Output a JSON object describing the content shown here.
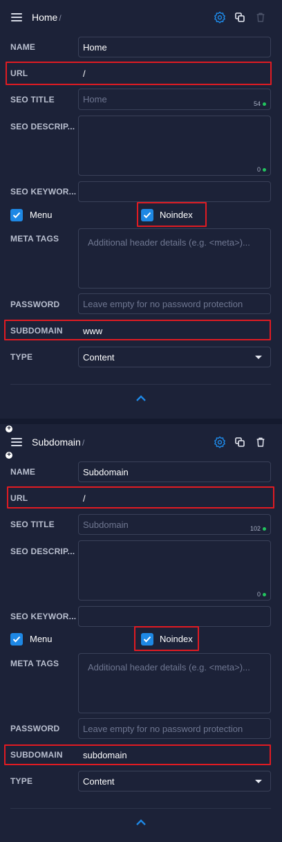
{
  "colors": {
    "accent": "#1e88e5",
    "highlight": "#e11b22",
    "ok_dot": "#22c55e"
  },
  "labels": {
    "name": "NAME",
    "url": "URL",
    "seo_title": "SEO TITLE",
    "seo_description": "SEO DESCRIP...",
    "seo_keywords": "SEO KEYWOR...",
    "meta_tags": "META TAGS",
    "password": "PASSWORD",
    "subdomain": "SUBDOMAIN",
    "type": "TYPE",
    "menu": "Menu",
    "noindex": "Noindex"
  },
  "placeholders": {
    "meta_tags": "Additional header details (e.g. <meta>)...",
    "password": "Leave empty for no password protection"
  },
  "icons": [
    "menu-icon",
    "settings-icon",
    "duplicate-icon",
    "trash-icon",
    "chevron-up-icon",
    "check-icon",
    "add-icon"
  ],
  "pages": [
    {
      "title": "Home",
      "name": "Home",
      "url": "/",
      "seo_title_placeholder": "Home",
      "seo_title_count": "54",
      "seo_description_count": "0",
      "menu_checked": true,
      "noindex_checked": true,
      "subdomain": "www",
      "type": "Content"
    },
    {
      "title": "Subdomain",
      "name": "Subdomain",
      "url": "/",
      "seo_title_placeholder": "Subdomain",
      "seo_title_count": "102",
      "seo_description_count": "0",
      "menu_checked": true,
      "noindex_checked": true,
      "subdomain": "subdomain",
      "type": "Content"
    }
  ],
  "separator_text": "/"
}
